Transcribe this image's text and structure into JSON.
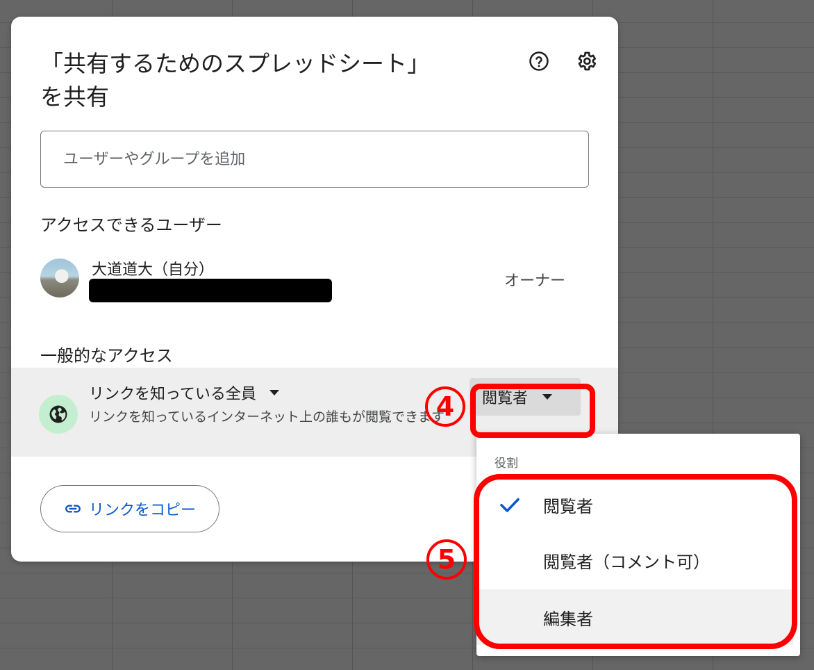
{
  "dialog": {
    "title_line1": "「共有するためのスプレッドシート」",
    "title_line2": "を共有",
    "help_icon": "help-circle-icon",
    "settings_icon": "gear-icon"
  },
  "add_people": {
    "placeholder": "ユーザーやグループを追加"
  },
  "people_with_access": {
    "heading": "アクセスできるユーザー",
    "users": [
      {
        "name": "大道道大（自分）",
        "role": "オーナー"
      }
    ]
  },
  "general_access": {
    "heading": "一般的なアクセス",
    "scope": "リンクを知っている全員",
    "description": "リンクを知っているインターネット上の誰もが閲覧できます",
    "role": "閲覧者"
  },
  "copy_link": {
    "label": "リンクをコピー"
  },
  "role_menu": {
    "heading": "役割",
    "items": [
      {
        "label": "閲覧者",
        "selected": true
      },
      {
        "label": "閲覧者（コメント可）",
        "selected": false
      },
      {
        "label": "編集者",
        "selected": false
      }
    ]
  },
  "annotations": {
    "step4": "4",
    "step5": "5"
  },
  "colors": {
    "accent_blue": "#0b57d0",
    "highlight_red": "#ff0000",
    "globe_bg": "#c4eed0"
  }
}
